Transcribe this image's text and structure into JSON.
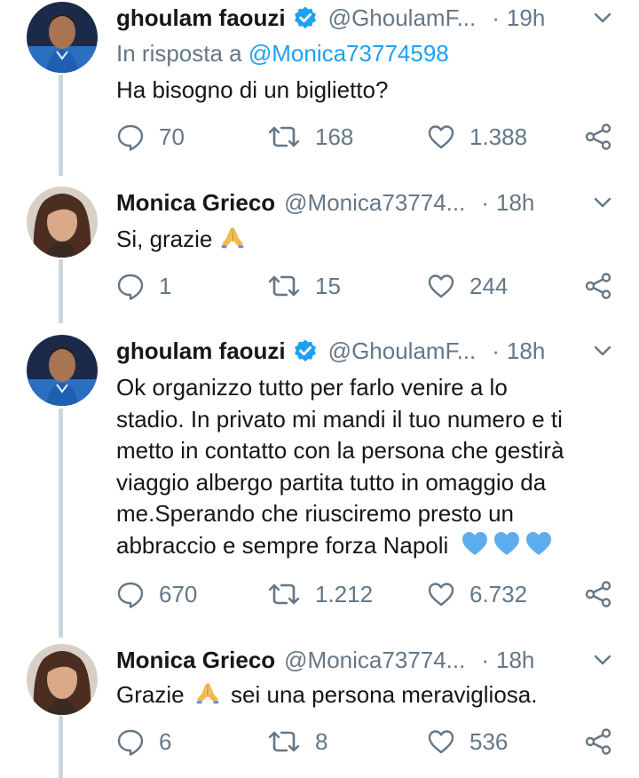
{
  "tweets": [
    {
      "name": "ghoulam faouzi",
      "verified": true,
      "handle": "@GhoulamF...",
      "time": "19h",
      "reply_prefix": "In risposta a",
      "reply_mention": "@Monica73774598",
      "text": "Ha bisogno di un biglietto?",
      "replies": "70",
      "retweets": "168",
      "likes": "1.388"
    },
    {
      "name": "Monica Grieco",
      "verified": false,
      "handle": "@Monica73774...",
      "time": "18h",
      "text": "Si, grazie",
      "emoji": "folded-hands",
      "replies": "1",
      "retweets": "15",
      "likes": "244"
    },
    {
      "name": "ghoulam faouzi",
      "verified": true,
      "handle": "@GhoulamF...",
      "time": "18h",
      "text_lines": [
        "Ok organizzo tutto per farlo venire a lo",
        "stadio. In privato mi mandi il tuo numero e ti",
        "metto in contatto con la persona che gestirà",
        "viaggio albergo partita tutto in omaggio da",
        "me.Sperando che riusciremo presto un",
        "abbraccio e sempre forza Napoli"
      ],
      "emoji": "blue-heart x3",
      "replies": "670",
      "retweets": "1.212",
      "likes": "6.732"
    },
    {
      "name": "Monica Grieco",
      "verified": false,
      "handle": "@Monica73774...",
      "time": "18h",
      "text_before": "Grazie",
      "text_after": "sei una persona meravigliosa.",
      "emoji": "folded-hands",
      "replies": "6",
      "retweets": "8",
      "likes": "536"
    }
  ],
  "separator": "·",
  "colors": {
    "text": "#14171a",
    "secondary": "#657786",
    "link": "#1da1f2",
    "thread_line": "#ccd6dd",
    "heart_emoji": "#5dadec"
  },
  "icons": {
    "reply": "reply-icon",
    "retweet": "retweet-icon",
    "like": "like-icon",
    "share": "share-icon",
    "verified": "verified-badge-icon",
    "more": "chevron-down-icon"
  }
}
